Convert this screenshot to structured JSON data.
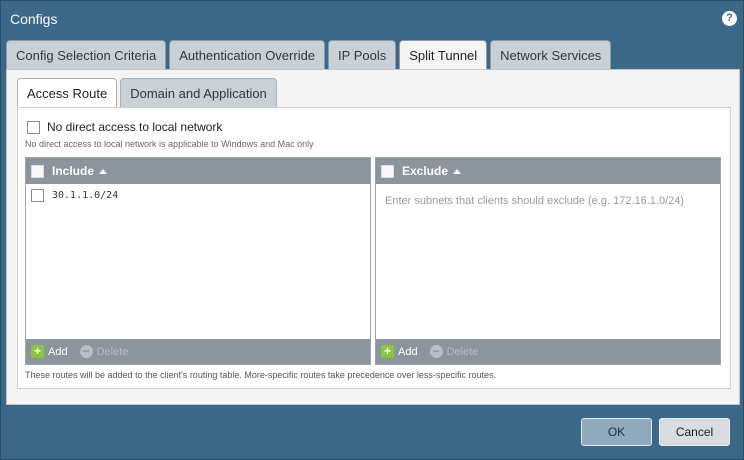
{
  "dialog": {
    "title": "Configs",
    "help_icon": "?"
  },
  "top_tabs": [
    {
      "label": "Config Selection Criteria"
    },
    {
      "label": "Authentication Override"
    },
    {
      "label": "IP Pools"
    },
    {
      "label": "Split Tunnel"
    },
    {
      "label": "Network Services"
    }
  ],
  "active_top_tab": "Split Tunnel",
  "sub_tabs": [
    {
      "label": "Access Route"
    },
    {
      "label": "Domain and Application"
    }
  ],
  "active_sub_tab": "Access Route",
  "no_direct": {
    "label": "No direct access to local network",
    "note": "No direct access to local network is applicable to Windows and Mac only"
  },
  "include": {
    "header": "Include",
    "rows": [
      "30.1.1.0/24"
    ],
    "add_label": "Add",
    "delete_label": "Delete"
  },
  "exclude": {
    "header": "Exclude",
    "placeholder": "Enter subnets that clients should exclude (e.g. 172.16.1.0/24)",
    "add_label": "Add",
    "delete_label": "Delete"
  },
  "routes_note": "These routes will be added to the client's routing table. More-specific routes take precedence over less-specific routes.",
  "buttons": {
    "ok": "OK",
    "cancel": "Cancel"
  }
}
